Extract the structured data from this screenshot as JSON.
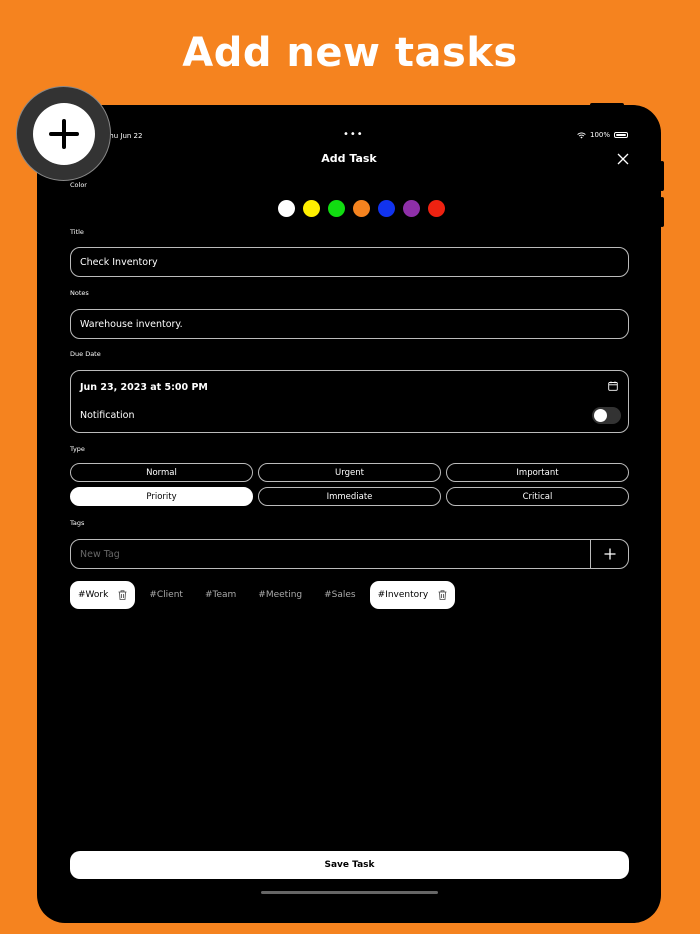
{
  "headline": "Add new tasks",
  "status_bar": {
    "date": "Thu Jun 22",
    "dots": "•••",
    "battery": "100%"
  },
  "nav": {
    "title": "Add Task"
  },
  "labels": {
    "color": "Color",
    "title": "Title",
    "notes": "Notes",
    "due_date": "Due Date",
    "type": "Type",
    "tags": "Tags"
  },
  "colors": [
    "#FFFFFF",
    "#FFEF00",
    "#11DD11",
    "#F5831F",
    "#1133EE",
    "#8E2FA8",
    "#EE2211"
  ],
  "fields": {
    "title_value": "Check Inventory",
    "notes_value": "Warehouse inventory."
  },
  "due": {
    "date_value": "Jun 23, 2023 at 5:00 PM",
    "notification_label": "Notification",
    "notification_on": false
  },
  "types": [
    {
      "label": "Normal",
      "selected": false
    },
    {
      "label": "Urgent",
      "selected": false
    },
    {
      "label": "Important",
      "selected": false
    },
    {
      "label": "Priority",
      "selected": true
    },
    {
      "label": "Immediate",
      "selected": false
    },
    {
      "label": "Critical",
      "selected": false
    }
  ],
  "tag_input": {
    "placeholder": "New Tag"
  },
  "tags": [
    {
      "label": "#Work",
      "active": true
    },
    {
      "label": "#Client",
      "active": false
    },
    {
      "label": "#Team",
      "active": false
    },
    {
      "label": "#Meeting",
      "active": false
    },
    {
      "label": "#Sales",
      "active": false
    },
    {
      "label": "#Inventory",
      "active": true
    }
  ],
  "save_label": "Save Task",
  "theme": {
    "background": "#F5831F",
    "screen": "#000000"
  }
}
